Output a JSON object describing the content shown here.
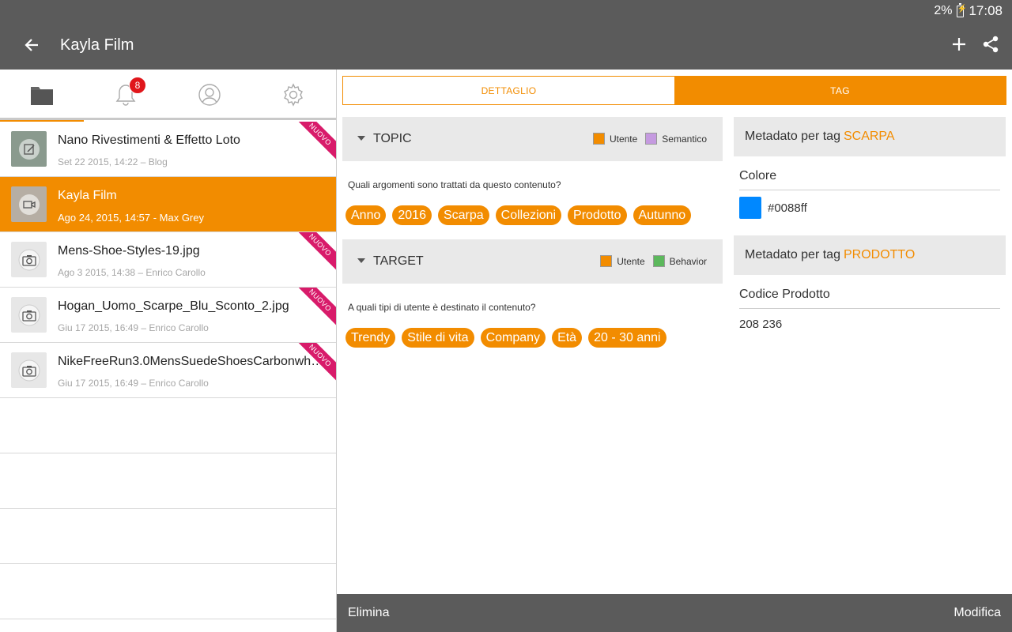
{
  "status": {
    "battery": "2%",
    "time": "17:08"
  },
  "appbar": {
    "title": "Kayla Film"
  },
  "tabs": {
    "notification_count": "8"
  },
  "list": [
    {
      "title": "Nano Rivestimenti & Effetto Loto",
      "meta": "Set 22 2015, 14:22  –  Blog",
      "ribbon": "NUOVO",
      "icon": "edit-icon"
    },
    {
      "title": "Kayla Film",
      "meta": "Ago 24, 2015, 14:57 - Max Grey",
      "ribbon": "",
      "icon": "video-icon"
    },
    {
      "title": "Mens-Shoe-Styles-19.jpg",
      "meta": "Ago 3 2015, 14:38  –  Enrico  Carollo",
      "ribbon": "NUOVO",
      "icon": "camera-icon"
    },
    {
      "title": "Hogan_Uomo_Scarpe_Blu_Sconto_2.jpg",
      "meta": "Giu 17 2015, 16:49  –  Enrico  Carollo",
      "ribbon": "NUOVO",
      "icon": "camera-icon"
    },
    {
      "title": "NikeFreeRun3.0MensSuedeShoesCarbonwhos…",
      "meta": "Giu 17 2015, 16:49  –  Enrico  Carollo",
      "ribbon": "NUOVO",
      "icon": "camera-icon"
    }
  ],
  "segment": {
    "detail": "DETTAGLIO",
    "tag": "TAG"
  },
  "topic": {
    "title": "TOPIC",
    "legend": [
      {
        "label": "Utente",
        "color": "#f28c00"
      },
      {
        "label": "Semantico",
        "color": "#c59ae0"
      }
    ],
    "question": "Quali argomenti sono trattati da questo contenuto?",
    "chips": [
      "Anno",
      "2016",
      "Scarpa",
      "Collezioni",
      "Prodotto",
      "Autunno"
    ]
  },
  "target": {
    "title": "TARGET",
    "legend": [
      {
        "label": "Utente",
        "color": "#f28c00"
      },
      {
        "label": "Behavior",
        "color": "#5cb85c"
      }
    ],
    "question": "A quali tipi di utente è destinato il contenuto?",
    "chips": [
      "Trendy",
      "Stile di vita",
      "Company",
      "Età",
      "20 - 30 anni"
    ]
  },
  "meta1": {
    "prefix": "Metadato per tag",
    "tag": "SCARPA",
    "field": "Colore",
    "value": "#0088ff",
    "swatch": "#0088ff"
  },
  "meta2": {
    "prefix": "Metadato per tag",
    "tag": "PRODOTTO",
    "field": "Codice Prodotto",
    "value": "208 236"
  },
  "bottom": {
    "delete": "Elimina",
    "edit": "Modifica"
  }
}
